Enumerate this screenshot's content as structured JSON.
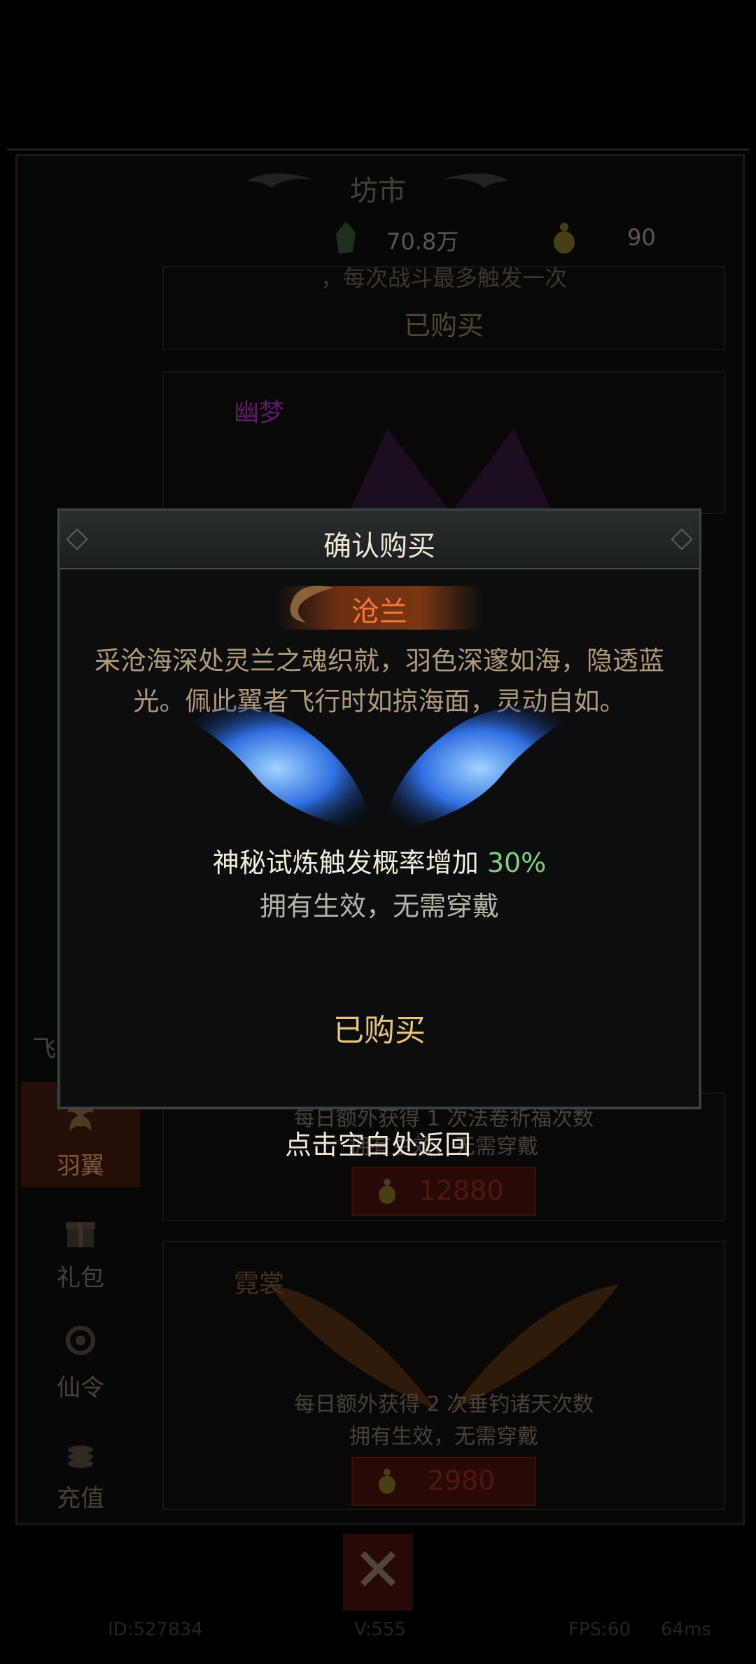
{
  "shop": {
    "title": "坊市",
    "jade_amount": "70.8万",
    "gourd_amount": "90",
    "tabs": [
      "飞",
      "羽翼",
      "礼包",
      "仙令",
      "充值"
    ],
    "cards": {
      "top_partial_text": "，每次战斗最多触发一次",
      "top_status": "已购买",
      "youmeng_name": "幽梦",
      "middle_line1": "每日额外获得 1 次法卷祈福次数",
      "middle_line2": "拥有生效，无需穿戴",
      "middle_price": "12880",
      "nichang_name": "霓裳",
      "bottom_line1": "每日额外获得 2 次垂钓诸天次数",
      "bottom_line2": "拥有生效，无需穿戴",
      "bottom_price": "2980"
    },
    "footer": {
      "id": "ID:527834",
      "version": "V:555",
      "fps": "FPS:60",
      "ping": "64ms"
    }
  },
  "modal": {
    "title": "确认购买",
    "item_name": "沧兰",
    "description": "采沧海深处灵兰之魂织就，羽色深邃如海，隐透蓝光。佩此翼者飞行时如掠海面，灵动自如。",
    "effect_text": "神秘试炼触发概率增加",
    "effect_value": "30%",
    "owned_note": "拥有生效，无需穿戴",
    "status_button": "已购买",
    "tap_to_return": "点击空白处返回"
  },
  "colors": {
    "accent_gold": "#e9c27a",
    "effect_green": "#7fd07b",
    "item_orange": "#f07a3a",
    "price_red": "#7a2418"
  },
  "icons": [
    "jade-icon",
    "gourd-coin-icon",
    "wing-tab-icon",
    "gift-icon",
    "token-icon",
    "coins-icon",
    "tools-icon",
    "wings-image"
  ]
}
